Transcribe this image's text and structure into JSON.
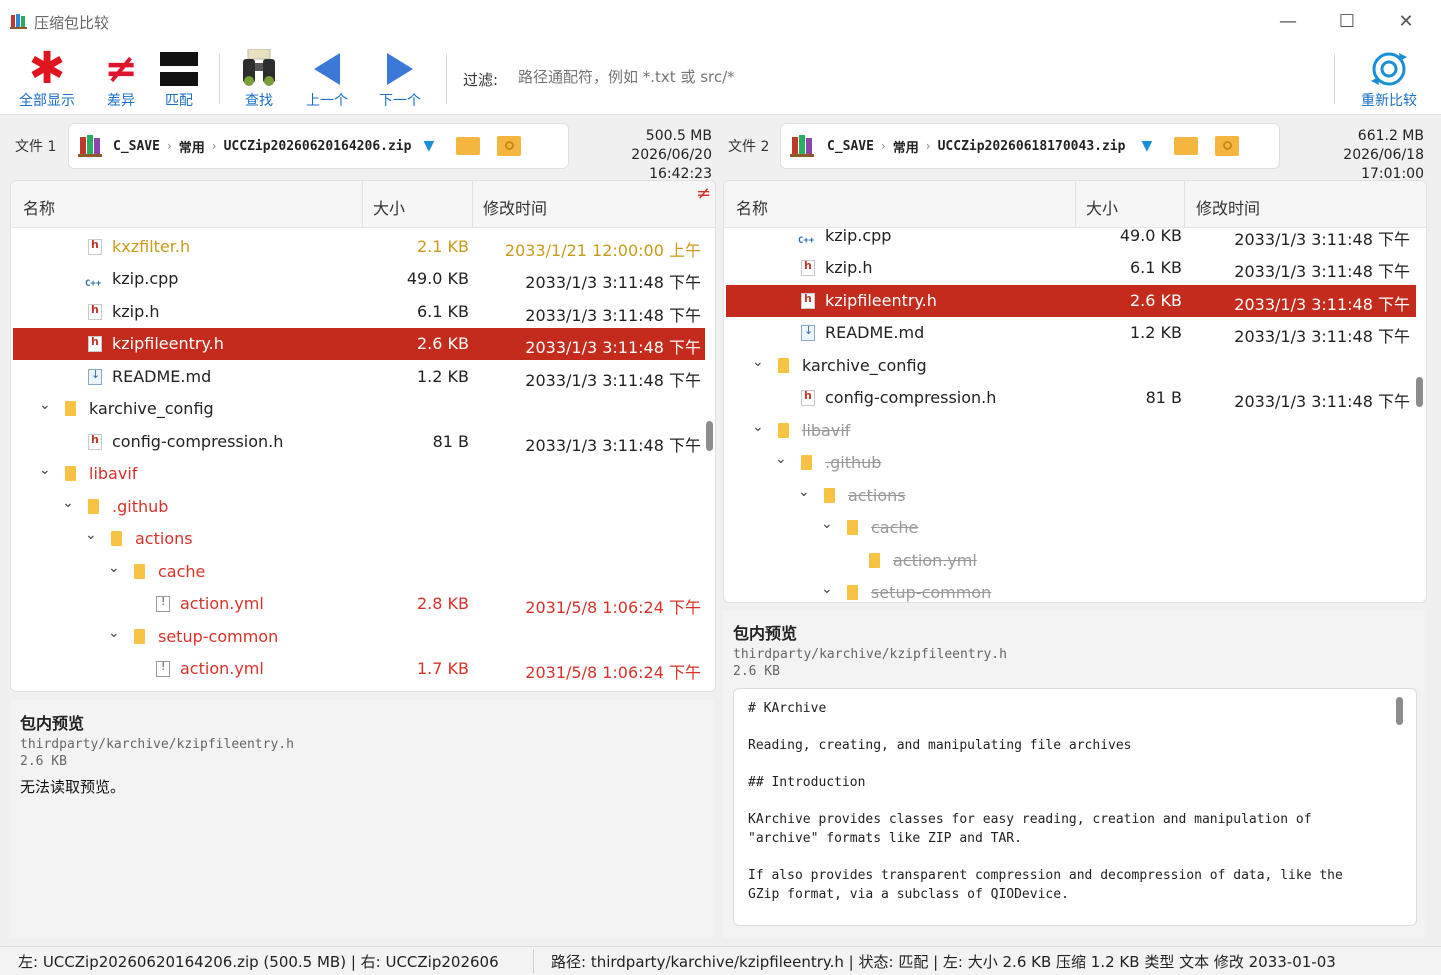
{
  "window": {
    "title": "压缩包比较",
    "min": "—",
    "max": "☐",
    "close": "✕"
  },
  "toolbar": {
    "all_label": "全部显示",
    "diff_label": "差异",
    "match_label": "匹配",
    "find_label": "查找",
    "prev_label": "上一个",
    "next_label": "下一个",
    "filter_label": "过滤:",
    "filter_placeholder": "路径通配符，例如 *.txt 或 src/*",
    "recompare_label": "重新比较"
  },
  "left": {
    "file_label": "文件 1",
    "crumbs": [
      "C_SAVE",
      "常用",
      "UCCZip20260620164206.zip"
    ],
    "size": "500.5 MB",
    "date": "2026/06/20 16:42:23",
    "headers": {
      "name": "名称",
      "size": "大小",
      "time": "修改时间"
    },
    "diff_mark": "≠",
    "rows": [
      {
        "name": "kxzfilter.h",
        "size": "2.1 KB",
        "time": "2033/1/21 12:00:00 上午",
        "icon": "h-file-icon"
      },
      {
        "name": "kzip.cpp",
        "size": "49.0 KB",
        "time": "2033/1/3 3:11:48 下午",
        "icon": "cpp-file-icon"
      },
      {
        "name": "kzip.h",
        "size": "6.1 KB",
        "time": "2033/1/3 3:11:48 下午",
        "icon": "h-file-icon"
      },
      {
        "name": "kzipfileentry.h",
        "size": "2.6 KB",
        "time": "2033/1/3 3:11:48 下午",
        "icon": "h-file-icon"
      },
      {
        "name": "README.md",
        "size": "1.2 KB",
        "time": "2033/1/3 3:11:48 下午",
        "icon": "md-file-icon"
      },
      {
        "name": "karchive_config",
        "size": "",
        "time": "",
        "icon": "folder-icon"
      },
      {
        "name": "config-compression.h",
        "size": "81 B",
        "time": "2033/1/3 3:11:48 下午",
        "icon": "h-file-icon"
      },
      {
        "name": "libavif",
        "size": "",
        "time": "",
        "icon": "folder-icon"
      },
      {
        "name": ".github",
        "size": "",
        "time": "",
        "icon": "folder-icon"
      },
      {
        "name": "actions",
        "size": "",
        "time": "",
        "icon": "folder-icon"
      },
      {
        "name": "cache",
        "size": "",
        "time": "",
        "icon": "folder-icon"
      },
      {
        "name": "action.yml",
        "size": "2.8 KB",
        "time": "2031/5/8 1:06:24 下午",
        "icon": "yml-file-icon"
      },
      {
        "name": "setup-common",
        "size": "",
        "time": "",
        "icon": "folder-icon"
      },
      {
        "name": "action.yml",
        "size": "1.7 KB",
        "time": "2031/5/8 1:06:24 下午",
        "icon": "yml-file-icon"
      }
    ],
    "preview": {
      "title": "包内预览",
      "path": "thirdparty/karchive/kzipfileentry.h",
      "size": "2.6 KB",
      "message": "无法读取预览。"
    }
  },
  "right": {
    "file_label": "文件 2",
    "crumbs": [
      "C_SAVE",
      "常用",
      "UCCZip20260618170043.zip"
    ],
    "size": "661.2 MB",
    "date": "2026/06/18 17:01:00",
    "headers": {
      "name": "名称",
      "size": "大小",
      "time": "修改时间"
    },
    "rows": [
      {
        "name": "kzip.cpp",
        "size": "49.0 KB",
        "time": "2033/1/3 3:11:48 下午",
        "icon": "cpp-file-icon"
      },
      {
        "name": "kzip.h",
        "size": "6.1 KB",
        "time": "2033/1/3 3:11:48 下午",
        "icon": "h-file-icon"
      },
      {
        "name": "kzipfileentry.h",
        "size": "2.6 KB",
        "time": "2033/1/3 3:11:48 下午",
        "icon": "h-file-icon"
      },
      {
        "name": "README.md",
        "size": "1.2 KB",
        "time": "2033/1/3 3:11:48 下午",
        "icon": "md-file-icon"
      },
      {
        "name": "karchive_config",
        "size": "",
        "time": "",
        "icon": "folder-icon"
      },
      {
        "name": "config-compression.h",
        "size": "81 B",
        "time": "2033/1/3 3:11:48 下午",
        "icon": "h-file-icon"
      },
      {
        "name": "libavif",
        "size": "",
        "time": "",
        "icon": "folder-icon"
      },
      {
        "name": ".github",
        "size": "",
        "time": "",
        "icon": "folder-icon"
      },
      {
        "name": "actions",
        "size": "",
        "time": "",
        "icon": "folder-icon"
      },
      {
        "name": "cache",
        "size": "",
        "time": "",
        "icon": "folder-icon"
      },
      {
        "name": "action.yml",
        "size": "",
        "time": "",
        "icon": "yml-file-icon"
      },
      {
        "name": "setup-common",
        "size": "",
        "time": "",
        "icon": "folder-icon"
      }
    ],
    "preview": {
      "title": "包内预览",
      "path": "thirdparty/karchive/kzipfileentry.h",
      "size": "2.6 KB",
      "lines": [
        "# KArchive",
        "",
        "Reading, creating, and manipulating file archives",
        "",
        "## Introduction",
        "",
        "KArchive provides classes for easy reading, creation and manipulation of",
        "\"archive\" formats like ZIP and TAR.",
        "",
        "If also provides transparent compression and decompression of data, like the",
        "GZip format, via a subclass of QIODevice."
      ]
    }
  },
  "status": {
    "left_part": "左: UCCZip20260620164206.zip (500.5 MB)  |  右: UCCZip202606",
    "right_part": "路径: thirdparty/karchive/kzipfileentry.h  |  状态: 匹配  |  左: 大小 2.6 KB  压缩 1.2 KB  类型 文本  修改 2033-01-03"
  },
  "colors": {
    "accent": "#1a6fc9",
    "selected": "#c42b1c",
    "diff": "#d9322a",
    "changed": "#c89a1a"
  }
}
